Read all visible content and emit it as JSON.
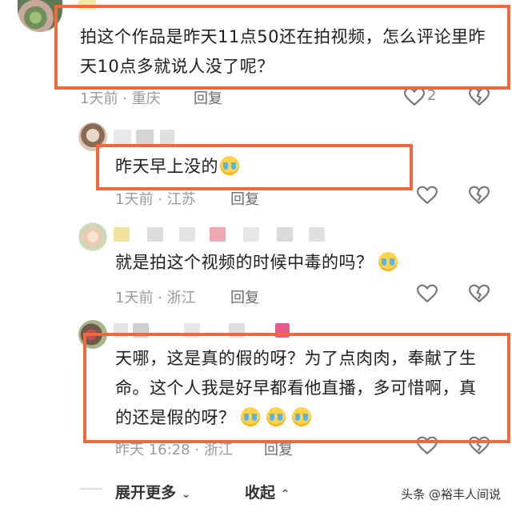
{
  "comments": [
    {
      "text": "拍这个作品是昨天11点50还在拍视频，怎么评论里昨天10点多就说人没了呢？",
      "time": "1天前",
      "location": "重庆",
      "reply": "回复",
      "likes": "2"
    },
    {
      "text": "昨天早上没的",
      "emoji_icons": [
        "crying-face-icon"
      ],
      "time": "1天前",
      "location": "江苏",
      "reply": "回复"
    },
    {
      "text": "就是拍这个视频的时候中毒的吗？",
      "emoji_icons": [
        "pleading-face-icon"
      ],
      "time": "1天前",
      "location": "浙江",
      "reply": "回复"
    },
    {
      "text": "天哪，这是真的假的呀？为了点肉肉，奉献了生命。这个人我是好早都看他直播，多可惜啊，真的还是假的呀？",
      "emoji_icons": [
        "crying-face-icon",
        "crying-face-icon",
        "crying-face-icon"
      ],
      "time": "昨天 16:28",
      "location": "浙江",
      "reply": "回复"
    }
  ],
  "footer": {
    "expand_more": "展开更多",
    "collapse": "收起"
  },
  "watermark": "头条 @裕丰人间说",
  "colors": {
    "highlight": "#f0683c",
    "meta_text": "#9a9a9a"
  }
}
